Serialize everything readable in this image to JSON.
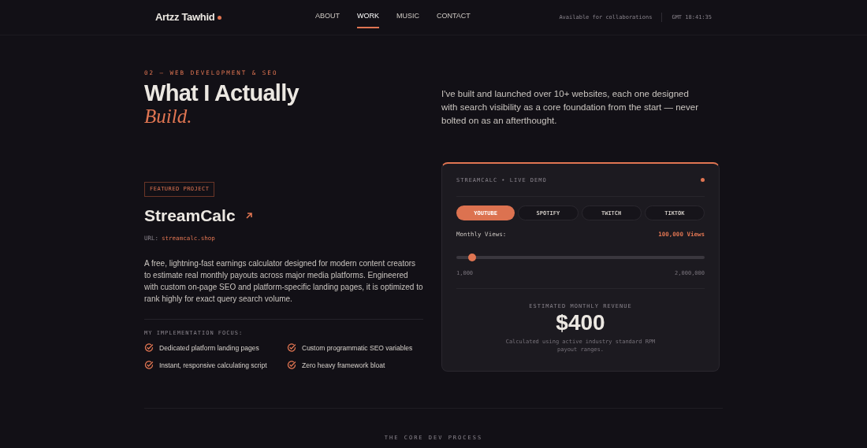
{
  "header": {
    "logo": "Artzz Tawhid",
    "nav": [
      {
        "label": "ABOUT",
        "selected": false
      },
      {
        "label": "WORK",
        "selected": true
      },
      {
        "label": "MUSIC",
        "selected": false
      },
      {
        "label": "CONTACT",
        "selected": false
      }
    ],
    "availability": "Available for collaborations",
    "clock": "GMT 18:41:35"
  },
  "section": {
    "eyebrow": "02 — WEB DEVELOPMENT & SEO",
    "title": "What I Actually",
    "title_accent": "Build.",
    "intro": "I've built and launched over 10+ websites, each one designed with search visibility as a core foundation from the start — never bolted on as an afterthought."
  },
  "project": {
    "badge": "FEATURED PROJECT",
    "name": "StreamCalc",
    "url_label": "URL:",
    "url": "streamcalc.shop",
    "description": "A free, lightning-fast earnings calculator designed for modern content creators to estimate real monthly payouts across major media platforms. Engineered with custom on-page SEO and platform-specific landing pages, it is optimized to rank highly for exact query search volume.",
    "focus_title": "MY IMPLEMENTATION FOCUS:",
    "focus": [
      "Dedicated platform landing pages",
      "Custom programmatic SEO variables",
      "Instant, responsive calculating script",
      "Zero heavy framework bloat"
    ]
  },
  "demo": {
    "title": "STREAMCALC • LIVE DEMO",
    "platforms": [
      {
        "label": "YOUTUBE",
        "selected": true
      },
      {
        "label": "SPOTIFY",
        "selected": false
      },
      {
        "label": "TWITCH",
        "selected": false
      },
      {
        "label": "TIKTOK",
        "selected": false
      }
    ],
    "slider_label": "Monthly Views:",
    "slider_value": "100,000 Views",
    "slider": {
      "level": 0.065
    },
    "min": "1,000",
    "max": "2,000,000",
    "revenue_label": "ESTIMATED MONTHLY REVENUE",
    "revenue": "$400",
    "note": "Calculated using active industry standard RPM payout ranges."
  },
  "next_section": "THE CORE DEV PROCESS"
}
